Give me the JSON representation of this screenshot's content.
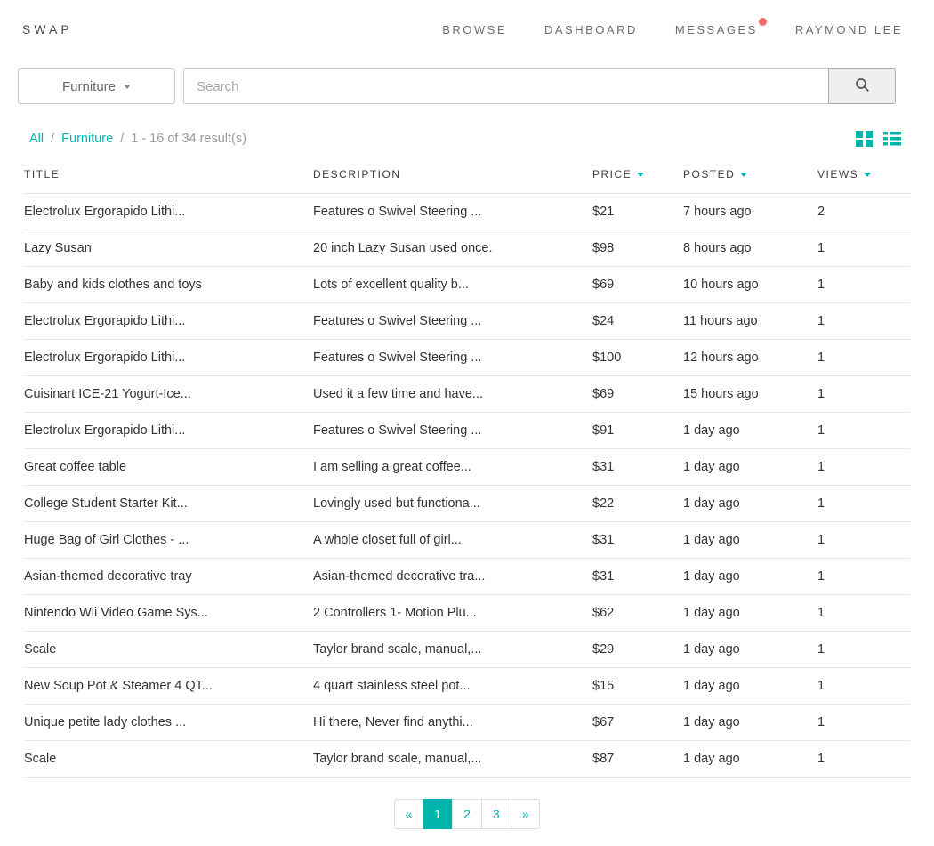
{
  "accent_color": "#00b5ad",
  "notification_color": "#f56a6a",
  "header": {
    "brand": "SWAP",
    "nav": [
      {
        "label": "BROWSE"
      },
      {
        "label": "DASHBOARD"
      },
      {
        "label": "MESSAGES",
        "has_notification": true
      },
      {
        "label": "RAYMOND LEE"
      }
    ]
  },
  "search": {
    "category": "Furniture",
    "placeholder": "Search"
  },
  "breadcrumb": {
    "links": [
      "All",
      "Furniture"
    ],
    "separator": "/",
    "result_count": "1 - 16 of 34 result(s)"
  },
  "table": {
    "columns": [
      {
        "label": "TITLE",
        "sortable": false
      },
      {
        "label": "DESCRIPTION",
        "sortable": false
      },
      {
        "label": "PRICE",
        "sortable": true
      },
      {
        "label": "POSTED",
        "sortable": true
      },
      {
        "label": "VIEWS",
        "sortable": true
      }
    ],
    "rows": [
      {
        "title": "Electrolux Ergorapido Lithi...",
        "description": "Features o Swivel Steering ...",
        "price": "$21",
        "posted": "7 hours ago",
        "views": "2"
      },
      {
        "title": "Lazy Susan",
        "description": "20 inch Lazy Susan used once.",
        "price": "$98",
        "posted": "8 hours ago",
        "views": "1"
      },
      {
        "title": "Baby and kids clothes and toys",
        "description": "Lots of excellent quality b...",
        "price": "$69",
        "posted": "10 hours ago",
        "views": "1"
      },
      {
        "title": "Electrolux Ergorapido Lithi...",
        "description": "Features o Swivel Steering ...",
        "price": "$24",
        "posted": "11 hours ago",
        "views": "1"
      },
      {
        "title": "Electrolux Ergorapido Lithi...",
        "description": "Features o Swivel Steering ...",
        "price": "$100",
        "posted": "12 hours ago",
        "views": "1"
      },
      {
        "title": "Cuisinart ICE-21 Yogurt-Ice...",
        "description": "Used it a few time and have...",
        "price": "$69",
        "posted": "15 hours ago",
        "views": "1"
      },
      {
        "title": "Electrolux Ergorapido Lithi...",
        "description": "Features o Swivel Steering ...",
        "price": "$91",
        "posted": "1 day ago",
        "views": "1"
      },
      {
        "title": "Great coffee table",
        "description": "I am selling a great coffee...",
        "price": "$31",
        "posted": "1 day ago",
        "views": "1"
      },
      {
        "title": "College Student Starter Kit...",
        "description": "Lovingly used but functiona...",
        "price": "$22",
        "posted": "1 day ago",
        "views": "1"
      },
      {
        "title": "Huge Bag of Girl Clothes - ...",
        "description": "A whole closet full of girl...",
        "price": "$31",
        "posted": "1 day ago",
        "views": "1"
      },
      {
        "title": "Asian-themed decorative tray",
        "description": "Asian-themed decorative tra...",
        "price": "$31",
        "posted": "1 day ago",
        "views": "1"
      },
      {
        "title": "Nintendo Wii Video Game Sys...",
        "description": "2 Controllers 1- Motion Plu...",
        "price": "$62",
        "posted": "1 day ago",
        "views": "1"
      },
      {
        "title": "Scale",
        "description": "Taylor brand scale, manual,...",
        "price": "$29",
        "posted": "1 day ago",
        "views": "1"
      },
      {
        "title": "New Soup Pot & Steamer 4 QT...",
        "description": "4 quart stainless steel pot...",
        "price": "$15",
        "posted": "1 day ago",
        "views": "1"
      },
      {
        "title": "Unique petite lady clothes ...",
        "description": "Hi there, Never find anythi...",
        "price": "$67",
        "posted": "1 day ago",
        "views": "1"
      },
      {
        "title": "Scale",
        "description": "Taylor brand scale, manual,...",
        "price": "$87",
        "posted": "1 day ago",
        "views": "1"
      }
    ]
  },
  "pagination": {
    "prev": "«",
    "pages": [
      "1",
      "2",
      "3"
    ],
    "active_page": "1",
    "next": "»"
  }
}
